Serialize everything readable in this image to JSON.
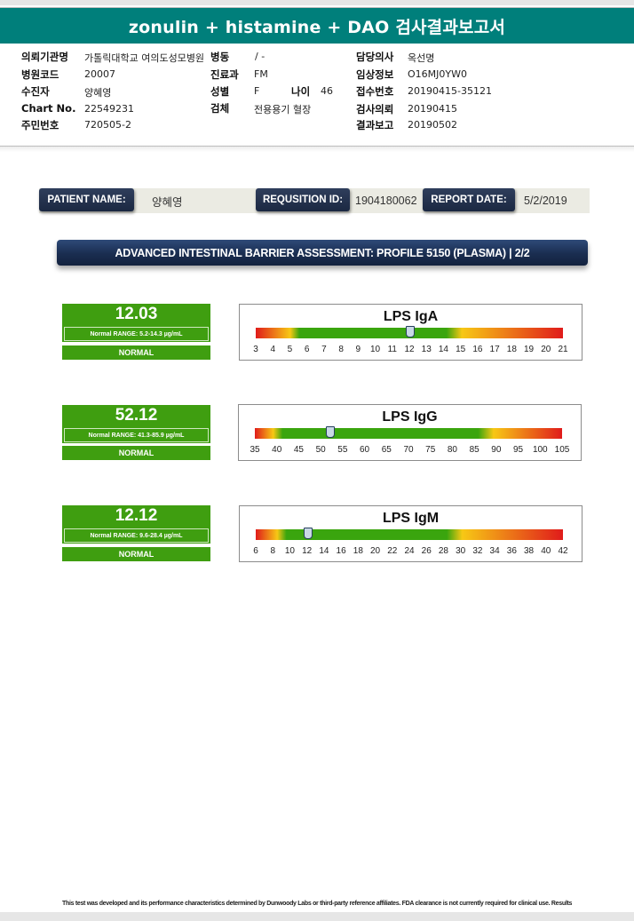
{
  "header": {
    "title": "zonulin + histamine + DAO 검사결과보고서"
  },
  "info": {
    "left": [
      {
        "label": "의뢰기관명",
        "value": "가톨릭대학교 여의도성모병원"
      },
      {
        "label": "병원코드",
        "value": "20007"
      },
      {
        "label": "수진자",
        "value": "양혜영"
      },
      {
        "label": "Chart No.",
        "value": "22549231"
      },
      {
        "label": "주민번호",
        "value": "720505-2"
      }
    ],
    "middle": [
      {
        "label": "병동",
        "value": "/ -"
      },
      {
        "label": "진료과",
        "value": "FM"
      },
      {
        "label": "성별",
        "value": "F"
      },
      {
        "label": "검체",
        "value": "전용용기 혈장"
      }
    ],
    "age": {
      "label": "나이",
      "value": "46"
    },
    "right": [
      {
        "label": "담당의사",
        "value": "옥선명"
      },
      {
        "label": "임상정보",
        "value": "O16MJ0YW0"
      },
      {
        "label": "접수번호",
        "value": "20190415-35121"
      },
      {
        "label": "검사의뢰",
        "value": "20190415"
      },
      {
        "label": "결과보고",
        "value": "20190502"
      }
    ]
  },
  "patient": {
    "name_label": "PATIENT NAME:",
    "name_value": "양혜영",
    "req_label": "REQUSITION ID:",
    "req_value": "1904180062",
    "date_label": "REPORT DATE:",
    "date_value": "5/2/2019"
  },
  "section": {
    "title": "ADVANCED INTESTINAL BARRIER ASSESSMENT: PROFILE 5150 (PLASMA) | 2/2"
  },
  "results": [
    {
      "name": "LPS IgA",
      "value": "12.03",
      "value_num": 12.03,
      "range_text": "Normal RANGE: 5.2-14.3 µg/mL",
      "status": "NORMAL",
      "ticks": [
        "3",
        "4",
        "5",
        "6",
        "7",
        "8",
        "9",
        "10",
        "11",
        "12",
        "13",
        "14",
        "15",
        "16",
        "17",
        "18",
        "19",
        "20",
        "21"
      ],
      "scale_min": 2.5,
      "scale_max": 21.5,
      "normal_low": 5.2,
      "normal_high": 14.3
    },
    {
      "name": "LPS IgG",
      "value": "52.12",
      "value_num": 52.12,
      "range_text": "Normal RANGE: 41.3-85.9 µg/mL",
      "status": "NORMAL",
      "ticks": [
        "35",
        "40",
        "45",
        "50",
        "55",
        "60",
        "65",
        "70",
        "75",
        "80",
        "85",
        "90",
        "95",
        "100",
        "105"
      ],
      "scale_min": 35,
      "scale_max": 105,
      "normal_low": 41.3,
      "normal_high": 85.9
    },
    {
      "name": "LPS IgM",
      "value": "12.12",
      "value_num": 12.12,
      "range_text": "Normal RANGE: 9.6-28.4 µg/mL",
      "status": "NORMAL",
      "ticks": [
        "6",
        "8",
        "10",
        "12",
        "14",
        "16",
        "18",
        "20",
        "22",
        "24",
        "26",
        "28",
        "30",
        "32",
        "34",
        "36",
        "38",
        "40",
        "42"
      ],
      "scale_min": 6,
      "scale_max": 42,
      "normal_low": 9.6,
      "normal_high": 28.4
    }
  ],
  "footer": {
    "text": "This test was developed and its performance characteristics determined by Dunwoody Labs or third-party reference affiliates. FDA clearance is not currently required for clinical use. Results"
  },
  "colors": {
    "teal": "#007f7b",
    "navy": "#1b2842",
    "green": "#3f9e10"
  }
}
